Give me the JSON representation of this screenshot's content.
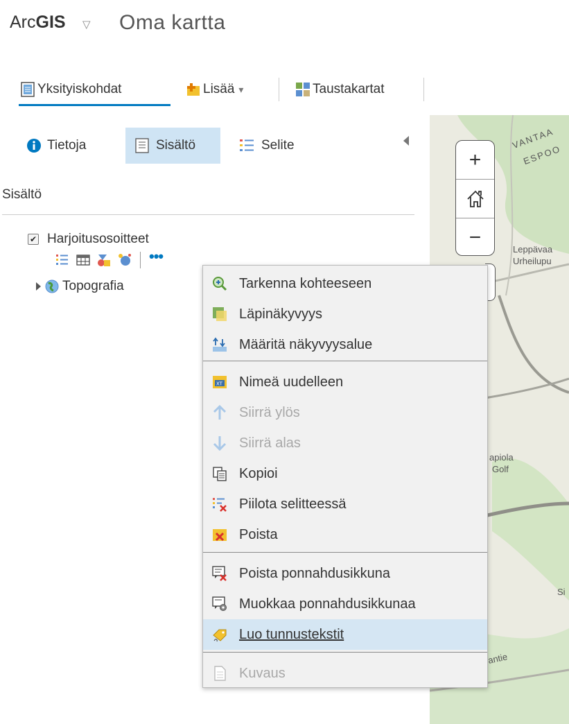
{
  "header": {
    "brand_prefix": "Arc",
    "brand_bold": "GIS",
    "brand_caret": "▽",
    "map_title": "Oma kartta"
  },
  "toolbar": {
    "details": "Yksityiskohdat",
    "add": "Lisää",
    "add_caret": "▾",
    "basemaps": "Taustakartat"
  },
  "panel": {
    "tabs": [
      {
        "label": "Tietoja"
      },
      {
        "label": "Sisältö"
      },
      {
        "label": "Selite"
      }
    ],
    "section_title": "Sisältö",
    "layers": [
      {
        "name": "Harjoitusosoitteet",
        "checked": true
      },
      {
        "name": "Topografia"
      }
    ],
    "more_dots": "•••"
  },
  "map": {
    "zoom_in": "+",
    "zoom_out": "−",
    "labels": [
      "VANTAA",
      "ESPOO",
      "Leppävaa",
      "Urheilupu",
      "apiola",
      "Golf",
      "Si",
      "antie"
    ]
  },
  "context_menu": {
    "items": [
      {
        "label": "Tarkenna kohteeseen",
        "icon": "zoom-to-icon",
        "enabled": true
      },
      {
        "label": "Läpinäkyvyys",
        "icon": "transparency-icon",
        "enabled": true
      },
      {
        "label": "Määritä näkyvyysalue",
        "icon": "visibility-range-icon",
        "enabled": true
      },
      {
        "label": "Nimeä uudelleen",
        "icon": "rename-icon",
        "enabled": true
      },
      {
        "label": "Siirrä ylös",
        "icon": "arrow-up-icon",
        "enabled": false
      },
      {
        "label": "Siirrä alas",
        "icon": "arrow-down-icon",
        "enabled": false
      },
      {
        "label": "Kopioi",
        "icon": "copy-icon",
        "enabled": true
      },
      {
        "label": "Piilota selitteessä",
        "icon": "hide-legend-icon",
        "enabled": true
      },
      {
        "label": "Poista",
        "icon": "remove-icon",
        "enabled": true
      },
      {
        "label": "Poista ponnahdusikkuna",
        "icon": "remove-popup-icon",
        "enabled": true
      },
      {
        "label": "Muokkaa ponnahdusikkunaa",
        "icon": "configure-popup-icon",
        "enabled": true
      },
      {
        "label": "Luo tunnustekstit",
        "icon": "create-labels-icon",
        "enabled": true,
        "hovered": true
      },
      {
        "label": "Kuvaus",
        "icon": "description-icon",
        "enabled": false
      }
    ]
  },
  "colors": {
    "accent": "#0079c1",
    "active_tab": "#cfe4f4",
    "menu_bg": "#f1f1f1",
    "menu_hover": "#d5e6f3",
    "map_bg": "#eaeae0"
  }
}
